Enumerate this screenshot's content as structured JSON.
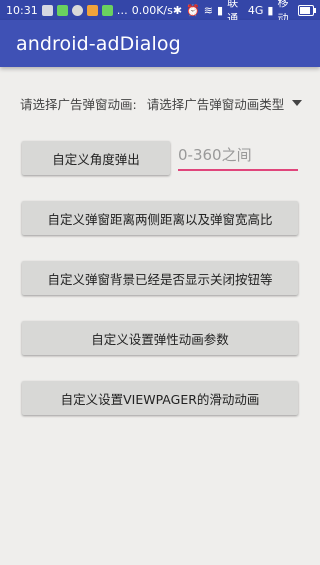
{
  "status_bar": {
    "time": "10:31",
    "network_speed": "0.00K/s",
    "carrier1": "联通",
    "network_type": "4G",
    "carrier2": "移动",
    "icons": [
      "notification-icon",
      "wechat-icon",
      "photo-icon",
      "weibo-icon",
      "android-icon",
      "more-icon",
      "bluetooth-icon",
      "alarm-icon",
      "wifi-icon",
      "signal-icon",
      "battery-icon"
    ],
    "battery_level": 0.6
  },
  "app_bar": {
    "title": "android-adDialog"
  },
  "spinner": {
    "label": "请选择广告弹窗动画:",
    "selected": "请选择广告弹窗动画类型"
  },
  "buttons": {
    "custom_angle": "自定义角度弹出",
    "custom_margin_ratio": "自定义弹窗距离两侧距离以及弹窗宽高比",
    "custom_background_close": "自定义弹窗背景已经是否显示关闭按钮等",
    "custom_elastic": "自定义设置弹性动画参数",
    "custom_viewpager": "自定义设置VIEWPAGER的滑动动画"
  },
  "angle_input": {
    "placeholder": "0-360之间",
    "value": ""
  },
  "colors": {
    "status_bar": "#3446a8",
    "app_bar": "#3f51b5",
    "input_underline": "#e0457b",
    "background": "#efeeec",
    "button": "#d8d8d6"
  }
}
